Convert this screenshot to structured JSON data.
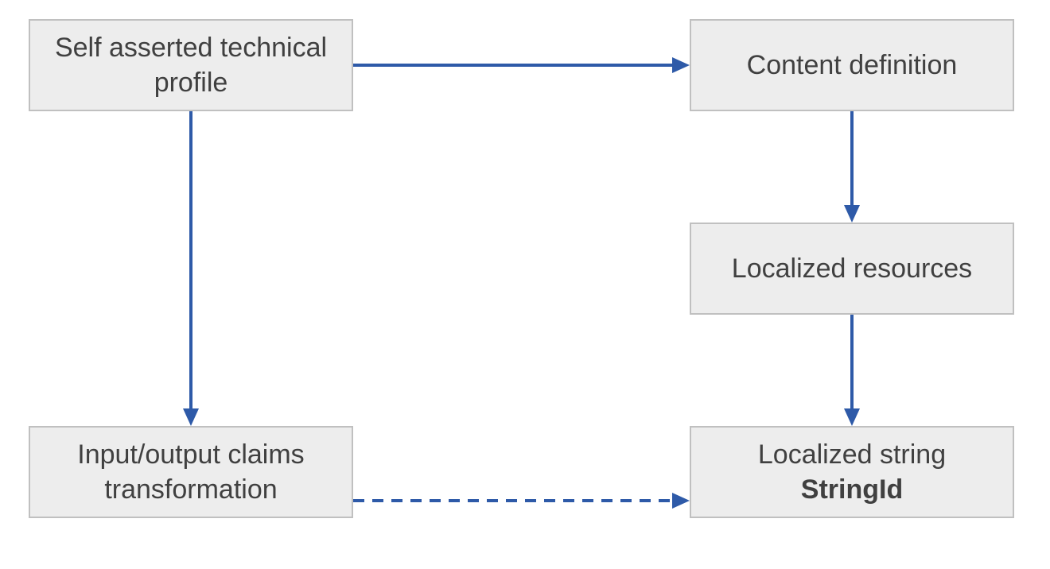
{
  "boxes": {
    "selfAsserted": {
      "line1": "Self asserted technical",
      "line2": "profile"
    },
    "contentDefinition": {
      "text": "Content definition"
    },
    "localizedResources": {
      "text": "Localized resources"
    },
    "inputOutputClaims": {
      "line1": "Input/output claims",
      "line2": "transformation"
    },
    "localizedString": {
      "line1": "Localized string",
      "line2": "StringId"
    }
  }
}
